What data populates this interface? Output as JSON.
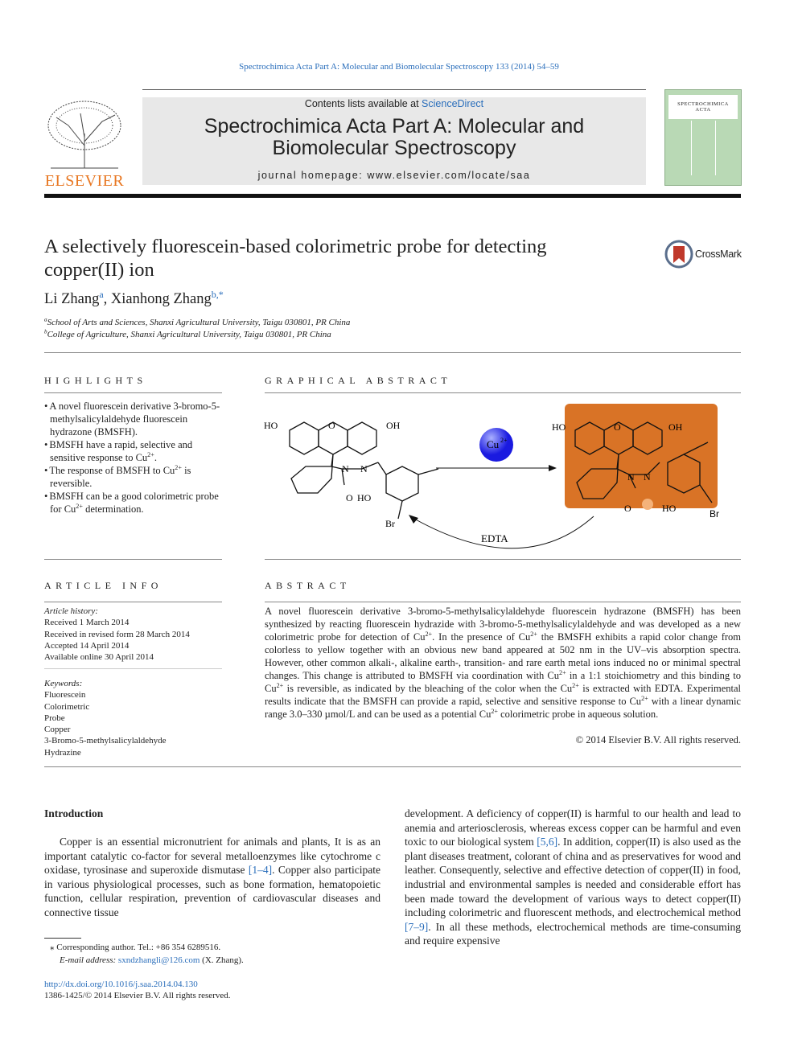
{
  "header": {
    "citation": "Spectrochimica Acta Part A: Molecular and Biomolecular Spectroscopy 133 (2014) 54–59",
    "contents_prefix": "Contents lists available at ",
    "contents_link": "ScienceDirect",
    "journal_title_1": "Spectrochimica Acta Part A: Molecular and",
    "journal_title_2": "Biomolecular Spectroscopy",
    "homepage_prefix": "journal homepage: ",
    "homepage_url": "www.elsevier.com/locate/saa",
    "publisher_logo": "ELSEVIER",
    "cover_title_1": "SPECTROCHIMICA",
    "cover_title_2": "ACTA"
  },
  "article": {
    "title": "A selectively fluorescein-based colorimetric probe for detecting copper(II) ion",
    "crossmark": "CrossMark",
    "authors": [
      {
        "name": "Li Zhang",
        "sup": "a"
      },
      {
        "name": "Xianhong Zhang",
        "sup": "b,*"
      }
    ],
    "author_sep": ", ",
    "affiliations": [
      {
        "sup": "a",
        "text": "School of Arts and Sciences, Shanxi Agricultural University, Taigu 030801, PR China"
      },
      {
        "sup": "b",
        "text": "College of Agriculture, Shanxi Agricultural University, Taigu 030801, PR China"
      }
    ]
  },
  "highlights": {
    "heading": "Highlights",
    "items": [
      [
        {
          "t": "A novel fluorescein derivative 3-bromo-5-methylsalicylaldehyde fluorescein hydrazone (BMSFH)."
        }
      ],
      [
        {
          "t": "BMSFH have a rapid, selective and sensitive response to Cu"
        },
        {
          "s": "2+"
        },
        {
          "t": "."
        }
      ],
      [
        {
          "t": "The response of BMSFH to Cu"
        },
        {
          "s": "2+"
        },
        {
          "t": " is reversible."
        }
      ],
      [
        {
          "t": "BMSFH can be a good colorimetric probe for Cu"
        },
        {
          "s": "2+"
        },
        {
          "t": " determination."
        }
      ]
    ]
  },
  "graphical_abstract": {
    "heading": "Graphical abstract",
    "labels": {
      "ho": "HO",
      "oh": "OH",
      "o": "O",
      "n": "N",
      "br": "Br",
      "cu": "Cu",
      "cu_charge": "2+",
      "edta": "EDTA"
    },
    "complex_color": "#d97326"
  },
  "article_info": {
    "heading": "Article info",
    "history_label": "Article history:",
    "history": [
      "Received 1 March 2014",
      "Received in revised form 28 March 2014",
      "Accepted 14 April 2014",
      "Available online 30 April 2014"
    ],
    "keywords_label": "Keywords:",
    "keywords": [
      "Fluorescein",
      "Colorimetric",
      "Probe",
      "Copper",
      "3-Bromo-5-methylsalicylaldehyde",
      "Hydrazine"
    ]
  },
  "abstract": {
    "heading": "Abstract",
    "text": [
      {
        "t": "A novel fluorescein derivative 3-bromo-5-methylsalicylaldehyde fluorescein hydrazone (BMSFH) has been synthesized by reacting fluorescein hydrazide with 3-bromo-5-methylsalicylaldehyde and was developed as a new colorimetric probe for detection of Cu"
      },
      {
        "s": "2+"
      },
      {
        "t": ". In the presence of Cu"
      },
      {
        "s": "2+"
      },
      {
        "t": " the BMSFH exhibits a rapid color change from colorless to yellow together with an obvious new band appeared at 502 nm in the UV–vis absorption spectra. However, other common alkali-, alkaline earth-, transition- and rare earth metal ions induced no or minimal spectral changes. This change is attributed to BMSFH via coordination with Cu"
      },
      {
        "s": "2+"
      },
      {
        "t": " in a 1:1 stoichiometry and this binding to Cu"
      },
      {
        "s": "2+"
      },
      {
        "t": " is reversible, as indicated by the bleaching of the color when the Cu"
      },
      {
        "s": "2+"
      },
      {
        "t": " is extracted with EDTA. Experimental results indicate that the BMSFH can provide a rapid, selective and sensitive response to Cu"
      },
      {
        "s": "2+"
      },
      {
        "t": " with a linear dynamic range 3.0–330 µmol/L and can be used as a potential Cu"
      },
      {
        "s": "2+"
      },
      {
        "t": " colorimetric probe in aqueous solution."
      }
    ],
    "copyright": "© 2014 Elsevier B.V. All rights reserved."
  },
  "intro": {
    "heading": "Introduction",
    "col1": [
      {
        "t": "Copper is an essential micronutrient for animals and plants, It is as an important catalytic co-factor for several metalloenzymes like cytochrome c oxidase, tyrosinase and superoxide dismutase "
      },
      {
        "l": "[1–4]"
      },
      {
        "t": ". Copper also participate in various physiological processes, such as bone formation, hematopoietic function, cellular respiration, prevention of cardiovascular diseases and connective tissue"
      }
    ],
    "col2": [
      {
        "t": "development. A deficiency of copper(II) is harmful to our health and lead to anemia and arteriosclerosis, whereas excess copper can be harmful and even toxic to our biological system "
      },
      {
        "l": "[5,6]"
      },
      {
        "t": ". In addition, copper(II) is also used as the plant diseases treatment, colorant of china and as preservatives for wood and leather. Consequently, selective and effective detection of copper(II) in food, industrial and environmental samples is needed and considerable effort has been made toward the development of various ways to detect copper(II) including colorimetric and fluorescent methods, and electrochemical method "
      },
      {
        "l": "[7–9]"
      },
      {
        "t": ". In all these methods, electrochemical methods are time-consuming and require expensive"
      }
    ]
  },
  "footnote": {
    "star": "⁎",
    "corresponding": "Corresponding author. Tel.: +86 354 6289516.",
    "email_label": "E-mail address: ",
    "email": "sxndzhangli@126.com",
    "email_suffix": " (X. Zhang).",
    "doi": "http://dx.doi.org/10.1016/j.saa.2014.04.130",
    "issn": "1386-1425/© 2014 Elsevier B.V. All rights reserved."
  }
}
